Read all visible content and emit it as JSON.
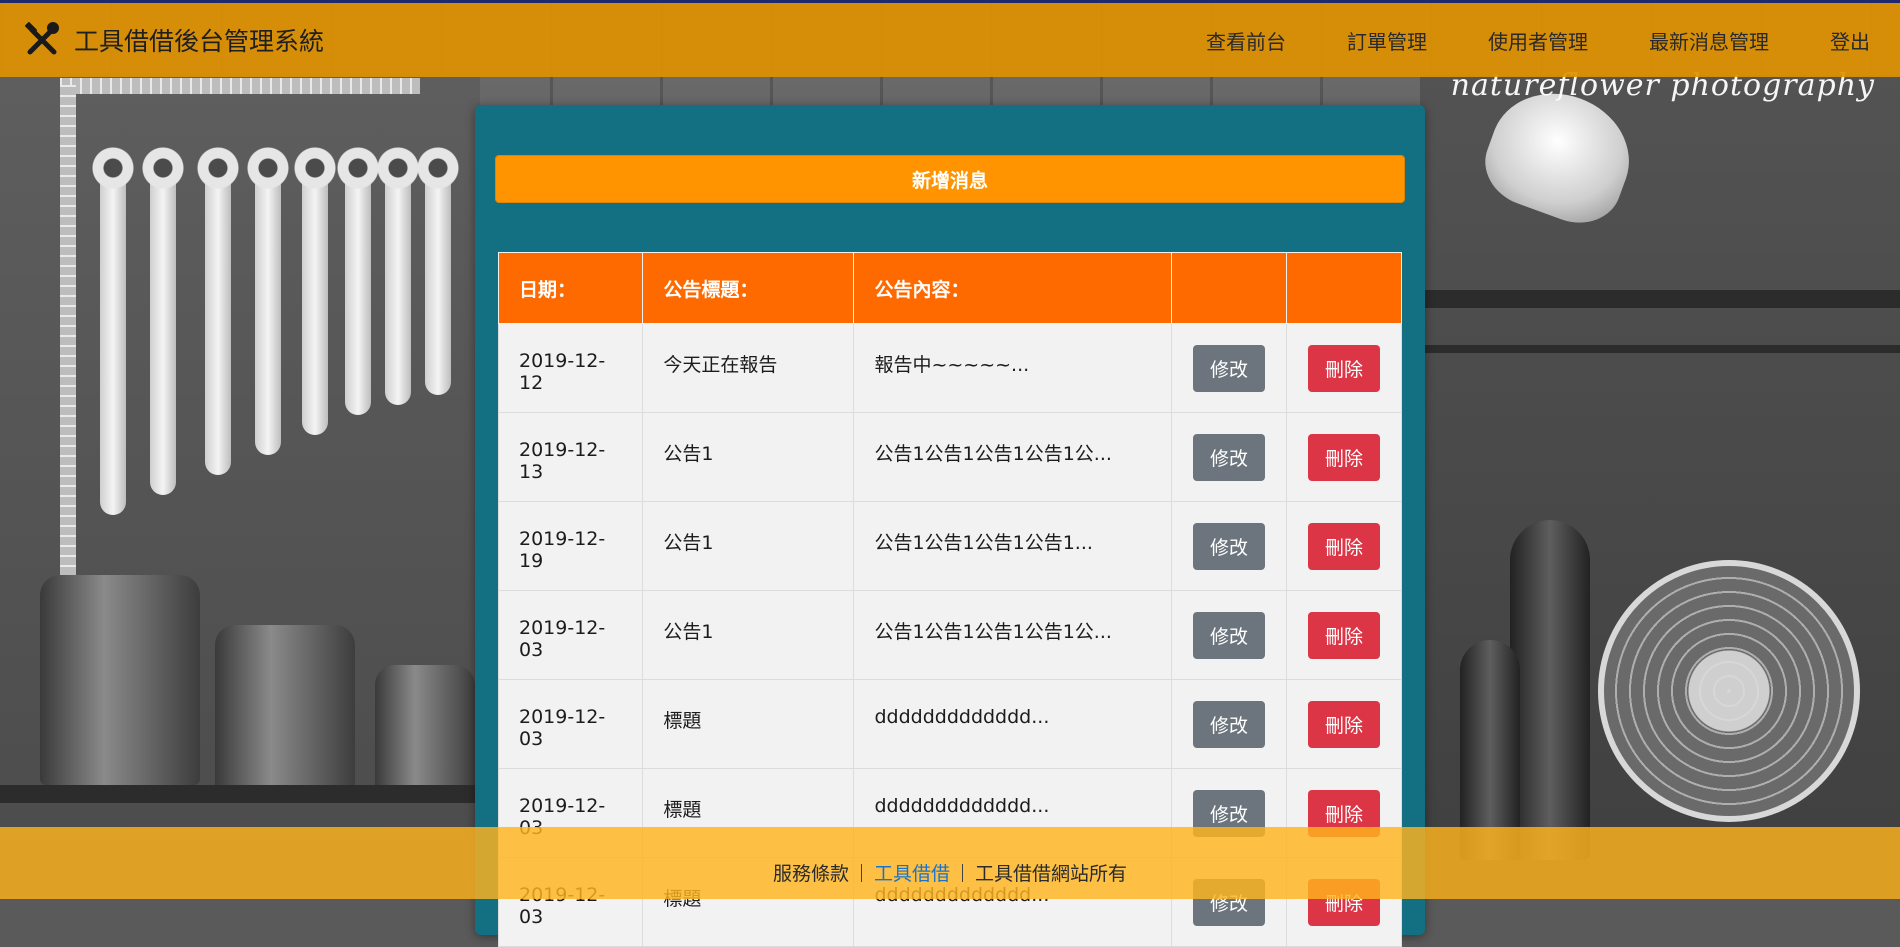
{
  "navbar": {
    "title": "工具借借後台管理系統",
    "links": [
      {
        "label": "查看前台"
      },
      {
        "label": "訂單管理"
      },
      {
        "label": "使用者管理"
      },
      {
        "label": "最新消息管理"
      },
      {
        "label": "登出"
      }
    ]
  },
  "background": {
    "watermark": "natureflower photography"
  },
  "panel": {
    "add_button": "新增消息",
    "table": {
      "headers": [
        "日期：",
        "公告標題：",
        "公告內容：",
        "",
        ""
      ],
      "edit_label": "修改",
      "delete_label": "刪除",
      "rows": [
        {
          "date": "2019-12-12",
          "title": "今天正在報告",
          "content": "報告中~~~~~..."
        },
        {
          "date": "2019-12-13",
          "title": "公告1",
          "content": "公告1公告1公告1公告1公..."
        },
        {
          "date": "2019-12-19",
          "title": "公告1",
          "content": "公告1公告1公告1公告1..."
        },
        {
          "date": "2019-12-03",
          "title": "公告1",
          "content": "公告1公告1公告1公告1公..."
        },
        {
          "date": "2019-12-03",
          "title": "標題",
          "content": "ddddddddddddd..."
        },
        {
          "date": "2019-12-03",
          "title": "標題",
          "content": "ddddddddddddd..."
        },
        {
          "date": "2019-12-03",
          "title": "標題",
          "content": "ddddddddddddd..."
        }
      ]
    }
  },
  "footer": {
    "items": [
      "服務條款",
      "工具借借",
      "工具借借網站所有"
    ]
  },
  "colors": {
    "navbar": "#df9100",
    "panel": "#136f82",
    "add_button": "#ff9400",
    "table_header": "#ff6a00",
    "edit_button": "#6c757d",
    "delete_button": "#dc3545",
    "footer_link": "#1a73c9"
  },
  "icons": {
    "brand": "tools-icon"
  }
}
